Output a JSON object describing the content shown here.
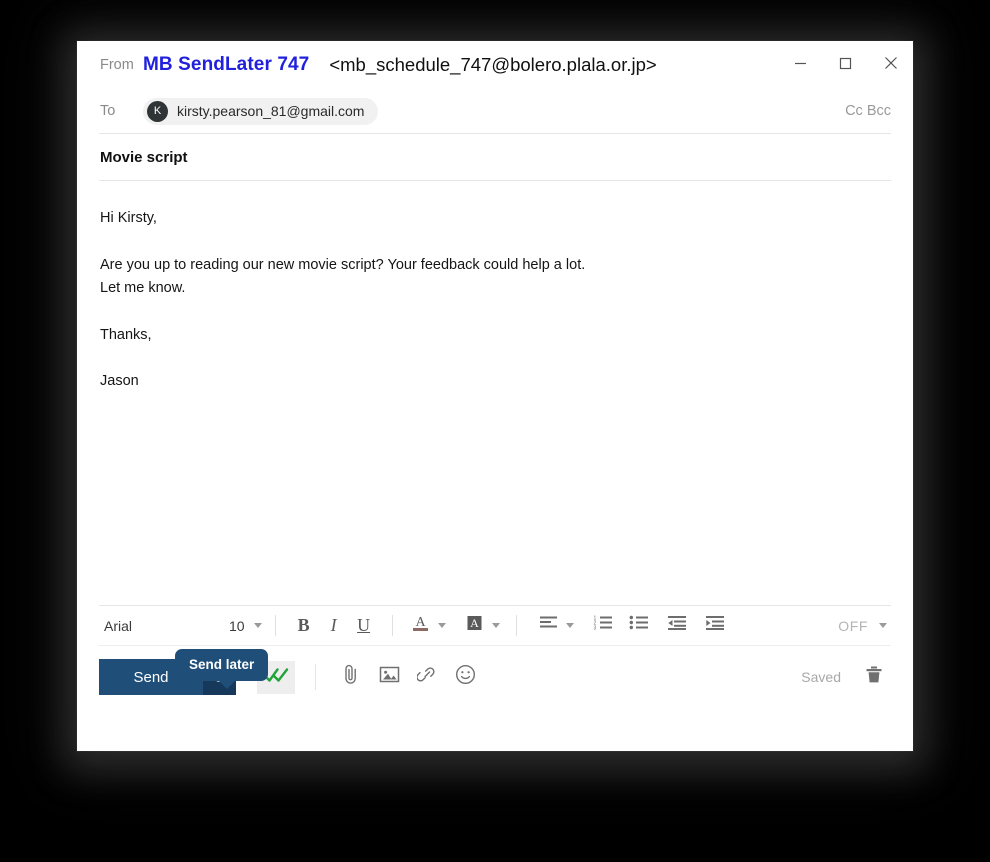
{
  "window": {
    "controls": [
      {
        "name": "minimize",
        "label": "Minimize"
      },
      {
        "name": "maximize",
        "label": "Maximize"
      },
      {
        "name": "close",
        "label": "Close"
      }
    ]
  },
  "header": {
    "from_label": "From",
    "from_name": "MB SendLater 747",
    "from_address": "<mb_schedule_747@bolero.plala.or.jp>",
    "from_name_color": "#2020dd",
    "to_label": "To",
    "recipient_initial": "K",
    "recipient_email": "kirsty.pearson_81@gmail.com",
    "cc_bcc_label": "Cc Bcc"
  },
  "subject": {
    "text": "Movie script"
  },
  "body": {
    "paragraphs": [
      "Hi Kirsty,",
      "Are you up to reading our new movie script? Your feedback could help a lot.\nLet me know.",
      "Thanks,",
      "Jason"
    ],
    "line1": "Hi Kirsty,",
    "line2": "Are you up to reading our new movie script? Your feedback could help a lot.",
    "line3": "Let me know.",
    "line4": "Thanks,",
    "line5": "Jason"
  },
  "format_toolbar": {
    "font_name": "Arial",
    "font_size": "10",
    "bold": "B",
    "italic": "I",
    "underline": "U",
    "text_color_glyph": "A",
    "highlight_glyph": "A",
    "off_label": "OFF",
    "buttons": [
      "bold",
      "italic",
      "underline",
      "text-color",
      "highlight-color",
      "align",
      "numbered-list",
      "bulleted-list",
      "decrease-indent",
      "increase-indent"
    ]
  },
  "action_bar": {
    "send_label": "Send",
    "send_later_icon": "clock-icon",
    "read_receipt_icon": "double-check-icon",
    "attach_icon": "paperclip-icon",
    "image_icon": "image-icon",
    "link_icon": "link-icon",
    "emoji_icon": "emoji-icon",
    "saved_label": "Saved",
    "delete_icon": "trash-icon",
    "send_button_color": "#1f4e79",
    "send_later_color": "#16385a",
    "check_color": "#22a33a"
  },
  "tooltip": {
    "text": "Send later",
    "background": "#1f4e79"
  }
}
